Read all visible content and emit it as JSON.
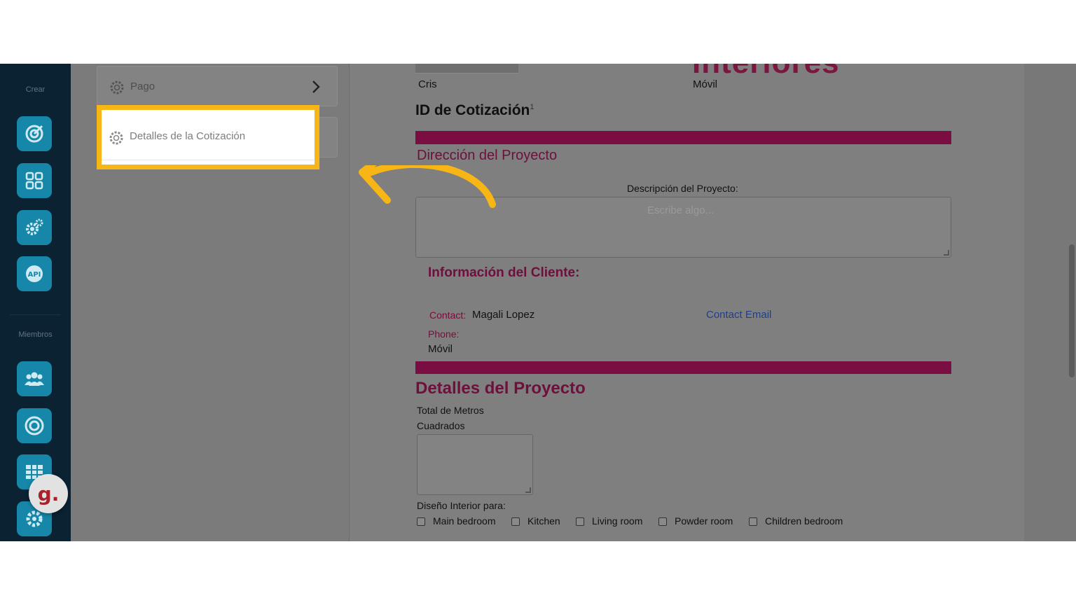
{
  "nav": {
    "section_create": "Crear",
    "section_members": "Miembros",
    "tiles_create": [
      "target-icon",
      "grid-icon",
      "gears-icon",
      "api-icon"
    ],
    "tiles_members": [
      "users-icon",
      "radar-icon",
      "apps-grid-icon",
      "settings-gear-icon"
    ],
    "api_text": "API",
    "badge": "g."
  },
  "settings": {
    "items": [
      {
        "label": "Pago"
      },
      {
        "label": "Detalles de la Cotización"
      }
    ]
  },
  "form": {
    "logo_fragment": "Interiores",
    "name_value": "Cris",
    "phone_type": "Móvil",
    "quote_id_label": "ID de Cotización",
    "quote_id_mark": "1",
    "project_address_title": "Dirección del Proyecto",
    "project_description_label": "Descripción del Proyecto:",
    "project_description_placeholder": "Escribe algo...",
    "client_info_title": "Información del Cliente:",
    "contact_label": "Contact:",
    "contact_value": "Magali Lopez",
    "contact_email_link": "Contact Email",
    "phone_label": "Phone:",
    "phone_value": "Móvil",
    "project_details_title": "Detalles del Proyecto",
    "total_meters_label_line1": "Total de Metros",
    "total_meters_label_line2": "Cuadrados",
    "interior_design_label": "Diseño Interior para:",
    "rooms": [
      "Main bedroom",
      "Kitchen",
      "Living room",
      "Powder room",
      "Children bedroom"
    ]
  },
  "colors": {
    "highlight": "#f8b616",
    "accent_bar": "#7a0d42",
    "nav_tile": "#1687a8",
    "nav_bg": "#0b2233"
  }
}
